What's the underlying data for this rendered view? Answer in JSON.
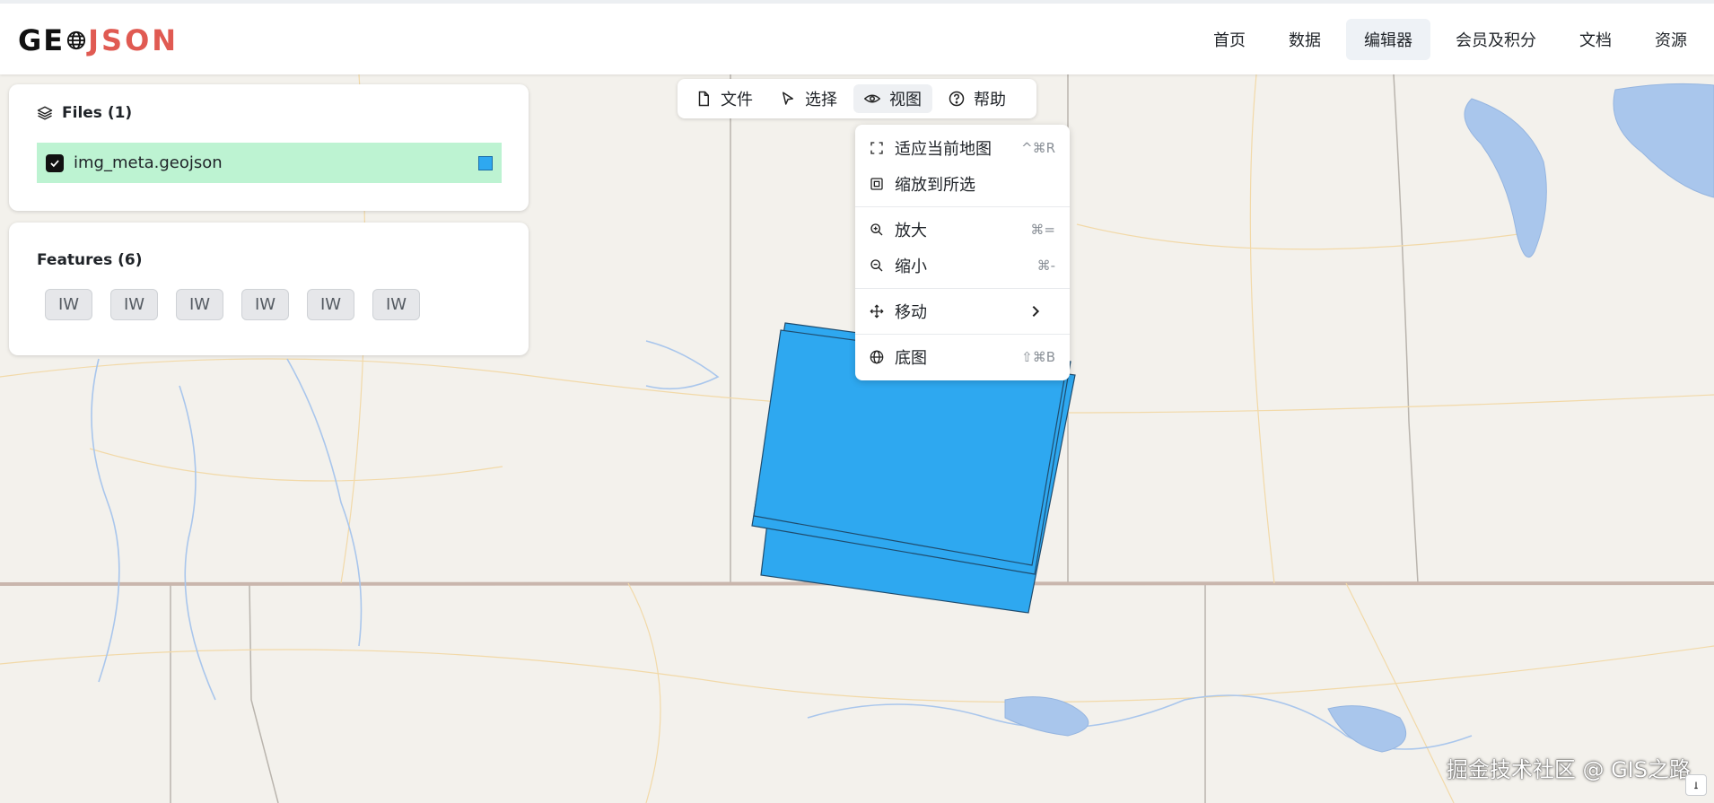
{
  "logo": {
    "left": "GE",
    "right": "JSON"
  },
  "nav": {
    "items": [
      {
        "label": "首页",
        "active": false
      },
      {
        "label": "数据",
        "active": false
      },
      {
        "label": "编辑器",
        "active": true
      },
      {
        "label": "会员及积分",
        "active": false
      },
      {
        "label": "文档",
        "active": false
      },
      {
        "label": "资源",
        "active": false
      }
    ]
  },
  "files_panel": {
    "title": "Files (1)",
    "file": {
      "name": "img_meta.geojson",
      "checked": true,
      "color": "#2ea8f0"
    }
  },
  "features_panel": {
    "title": "Features (6)",
    "chips": [
      "IW",
      "IW",
      "IW",
      "IW",
      "IW",
      "IW"
    ]
  },
  "toolbar": {
    "file": "文件",
    "select": "选择",
    "view": "视图",
    "help": "帮助"
  },
  "view_menu": {
    "fit_map": {
      "label": "适应当前地图",
      "shortcut": "^⌘R"
    },
    "zoom_selection": {
      "label": "缩放到所选",
      "shortcut": ""
    },
    "zoom_in": {
      "label": "放大",
      "shortcut": "⌘="
    },
    "zoom_out": {
      "label": "缩小",
      "shortcut": "⌘-"
    },
    "move": {
      "label": "移动",
      "shortcut": ""
    },
    "basemap": {
      "label": "底图",
      "shortcut": "⇧⌘B"
    }
  },
  "watermark": "掘金技术社区 @ GIS之路",
  "colors": {
    "accent_red": "#e05a52",
    "feature_fill": "#2ea8f0",
    "file_row_bg": "#bdf3d2",
    "map_bg": "#f3f1ec",
    "water": "#a9c6ec"
  }
}
